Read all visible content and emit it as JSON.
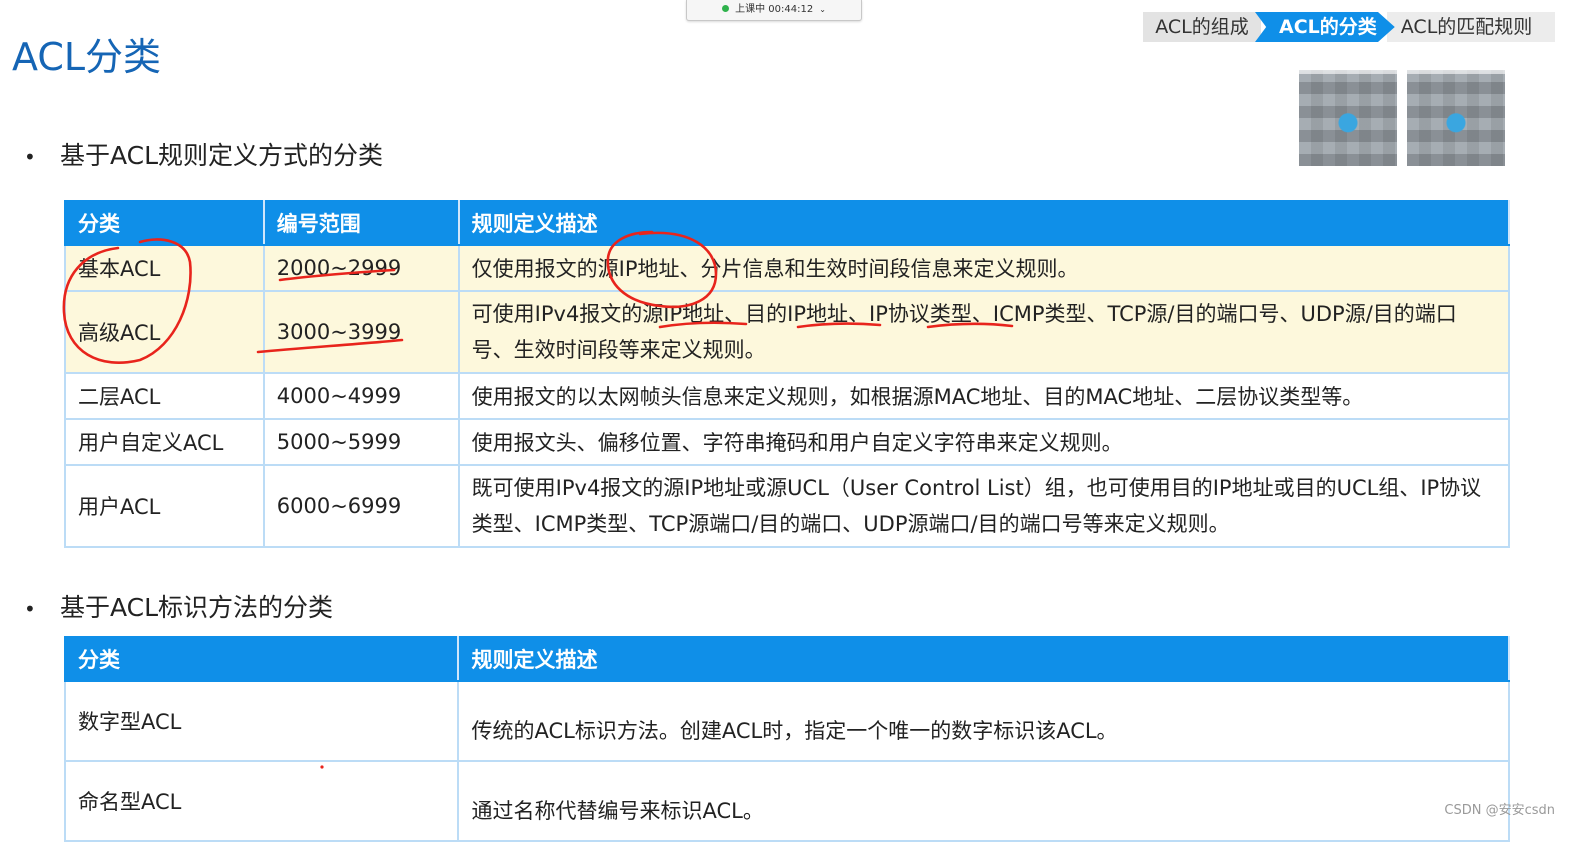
{
  "status_bar": {
    "text": "上课中 00:44:12"
  },
  "breadcrumb": [
    "ACL的组成",
    "ACL的分类",
    "ACL的匹配规则"
  ],
  "title": "ACL分类",
  "section1": {
    "heading": "基于ACL规则定义方式的分类",
    "headers": [
      "分类",
      "编号范围",
      "规则定义描述"
    ],
    "rows": [
      {
        "category": "基本ACL",
        "range": "2000~2999",
        "desc": "仅使用报文的源IP地址、分片信息和生效时间段信息来定义规则。"
      },
      {
        "category": "高级ACL",
        "range": "3000~3999",
        "desc": "可使用IPv4报文的源IP地址、目的IP地址、IP协议类型、ICMP类型、TCP源/目的端口号、UDP源/目的端口号、生效时间段等来定义规则。"
      },
      {
        "category": "二层ACL",
        "range": "4000~4999",
        "desc": "使用报文的以太网帧头信息来定义规则，如根据源MAC地址、目的MAC地址、二层协议类型等。"
      },
      {
        "category": "用户自定义ACL",
        "range": "5000~5999",
        "desc": "使用报文头、偏移位置、字符串掩码和用户自定义字符串来定义规则。"
      },
      {
        "category": "用户ACL",
        "range": "6000~6999",
        "desc": "既可使用IPv4报文的源IP地址或源UCL（User Control List）组，也可使用目的IP地址或目的UCL组、IP协议类型、ICMP类型、TCP源端口/目的端口、UDP源端口/目的端口号等来定义规则。"
      }
    ]
  },
  "section2": {
    "heading": "基于ACL标识方法的分类",
    "headers": [
      "分类",
      "规则定义描述"
    ],
    "rows": [
      {
        "category": "数字型ACL",
        "desc": "传统的ACL标识方法。创建ACL时，指定一个唯一的数字标识该ACL。"
      },
      {
        "category": "命名型ACL",
        "desc": "通过名称代替编号来标识ACL。"
      }
    ]
  },
  "watermark": "CSDN @安安csdn",
  "colors": {
    "accent": "#0f8fe8",
    "title": "#1565b5",
    "highlight": "#fdf8dc",
    "annotation": "#e8241c"
  }
}
